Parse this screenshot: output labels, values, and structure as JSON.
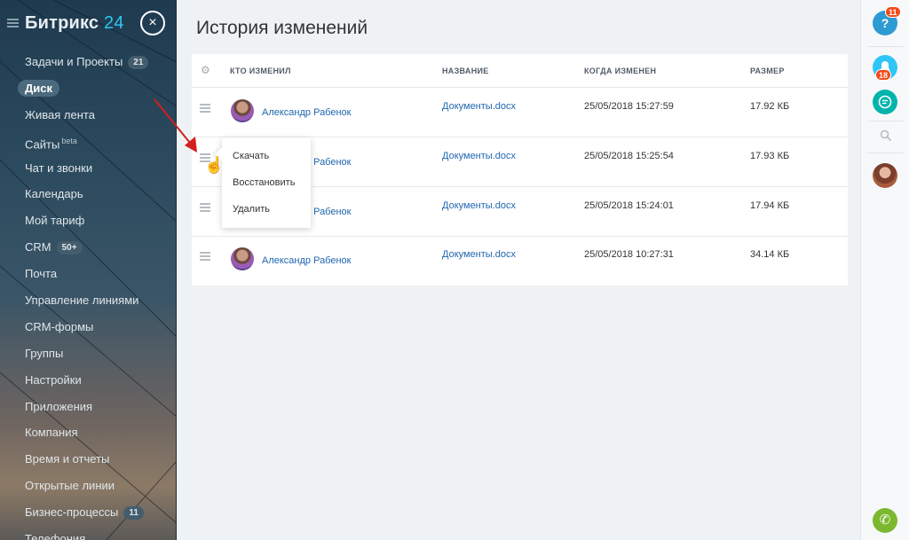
{
  "app": {
    "logo_name": "Битрикс",
    "logo_num": "24",
    "close_icon": "×"
  },
  "sidebar": {
    "items": [
      {
        "label": "Задачи и Проекты",
        "counter": "21"
      },
      {
        "label": "Диск",
        "active": true
      },
      {
        "label": "Живая лента"
      },
      {
        "label": "Сайты",
        "sup": "beta"
      },
      {
        "label": "Чат и звонки"
      },
      {
        "label": "Календарь"
      },
      {
        "label": "Мой тариф"
      },
      {
        "label": "CRM",
        "counter": "50+"
      },
      {
        "label": "Почта"
      },
      {
        "label": "Управление линиями"
      },
      {
        "label": "CRM-формы"
      },
      {
        "label": "Группы"
      },
      {
        "label": "Настройки"
      },
      {
        "label": "Приложения"
      },
      {
        "label": "Компания"
      },
      {
        "label": "Время и отчеты"
      },
      {
        "label": "Открытые линии"
      },
      {
        "label": "Бизнес-процессы",
        "counter": "11"
      },
      {
        "label": "Телефония"
      }
    ]
  },
  "main": {
    "title": "История изменений",
    "columns": {
      "author": "КТО ИЗМЕНИЛ",
      "name": "НАЗВАНИЕ",
      "changed": "КОГДА ИЗМЕНЕН",
      "size": "РАЗМЕР"
    },
    "rows": [
      {
        "author": "Александр Рабенок",
        "name": "Документы.docx",
        "changed": "25/05/2018 15:27:59",
        "size": "17.92 КБ"
      },
      {
        "author": "Александр Рабенок",
        "name": "Документы.docx",
        "changed": "25/05/2018 15:25:54",
        "size": "17.93 КБ"
      },
      {
        "author": "Александр Рабенок",
        "name": "Документы.docx",
        "changed": "25/05/2018 15:24:01",
        "size": "17.94 КБ"
      },
      {
        "author": "Александр Рабенок",
        "name": "Документы.docx",
        "changed": "25/05/2018 10:27:31",
        "size": "34.14 КБ"
      }
    ]
  },
  "popup": {
    "items": [
      "Скачать",
      "Восстановить",
      "Удалить"
    ]
  },
  "rightbar": {
    "help_icon": "?",
    "help_badge": "11",
    "notify_badge": "18",
    "phone_icon": "✆"
  },
  "colors": {
    "accent": "#2fc6f6",
    "link": "#2067b0",
    "badge": "#f54819",
    "phone": "#7cb82f"
  }
}
